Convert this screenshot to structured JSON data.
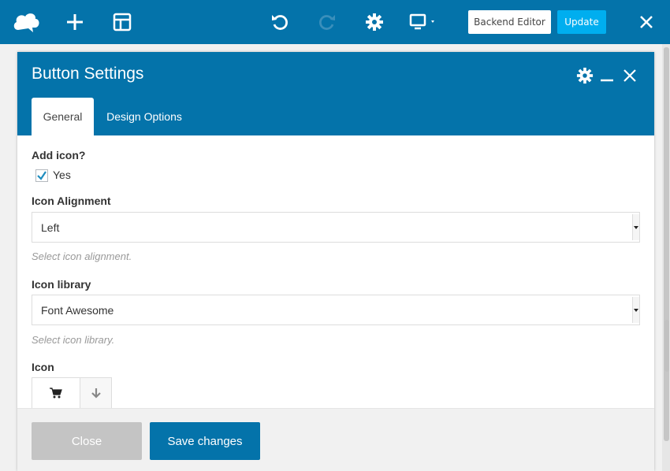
{
  "toolbar": {
    "logo_icon": "cloud-logo-icon",
    "add_icon": "plus-icon",
    "layout_icon": "template-icon",
    "undo_icon": "undo-icon",
    "redo_icon": "redo-icon",
    "settings_icon": "gear-icon",
    "device_icon": "monitor-icon",
    "backend_editor_label": "Backend Editor",
    "update_label": "Update",
    "close_icon": "close-icon",
    "colors": {
      "bar": "#0473aa",
      "update": "#00aeef"
    }
  },
  "modal": {
    "title": "Button Settings",
    "tabs": [
      {
        "label": "General",
        "active": true
      },
      {
        "label": "Design Options",
        "active": false
      }
    ],
    "fields": {
      "add_icon": {
        "label": "Add icon?",
        "option_label": "Yes",
        "checked": true
      },
      "icon_alignment": {
        "label": "Icon Alignment",
        "value": "Left",
        "help": "Select icon alignment."
      },
      "icon_library": {
        "label": "Icon library",
        "value": "Font Awesome",
        "help": "Select icon library."
      },
      "icon": {
        "label": "Icon",
        "selected_icon": "shopping-cart-icon"
      }
    },
    "footer": {
      "close_label": "Close",
      "save_label": "Save changes"
    }
  }
}
